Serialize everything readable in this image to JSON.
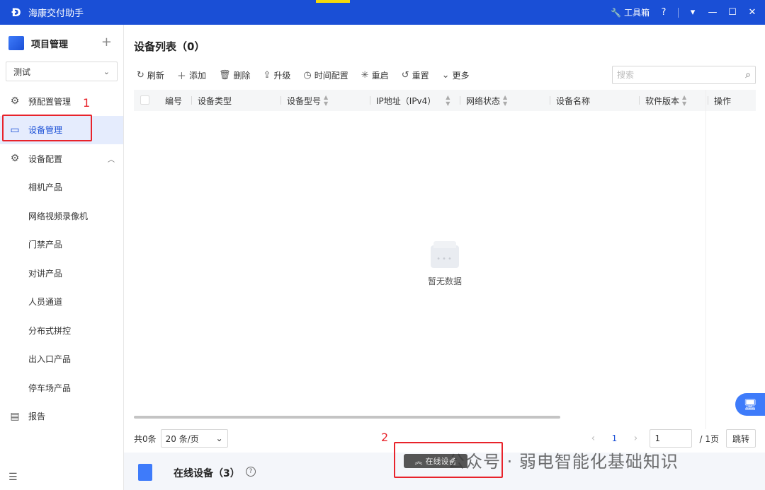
{
  "window": {
    "title": "海康交付助手",
    "toolbox_label": "工具箱",
    "help_icon": "question-circle-icon",
    "min_icon": "minimize-icon",
    "max_icon": "maximize-icon",
    "close_icon": "close-icon"
  },
  "sidebar": {
    "header_label": "项目管理",
    "project_selected": "测试",
    "items": [
      {
        "label": "预配置管理",
        "icon": "gear-cluster-icon"
      },
      {
        "label": "设备管理",
        "icon": "device-card-icon",
        "active": true
      },
      {
        "label": "设备配置",
        "icon": "device-config-icon",
        "expanded": true
      },
      {
        "label": "相机产品"
      },
      {
        "label": "网络视频录像机"
      },
      {
        "label": "门禁产品"
      },
      {
        "label": "对讲产品"
      },
      {
        "label": "人员通道"
      },
      {
        "label": "分布式拼控"
      },
      {
        "label": "出入口产品"
      },
      {
        "label": "停车场产品"
      },
      {
        "label": "报告",
        "icon": "report-icon"
      }
    ]
  },
  "main": {
    "title": "设备列表（0）",
    "toolbar": {
      "refresh": "刷新",
      "add": "添加",
      "delete": "删除",
      "upgrade": "升级",
      "time_config": "时间配置",
      "reboot": "重启",
      "reset": "重置",
      "more": "更多"
    },
    "search_placeholder": "搜索",
    "columns": [
      "编号",
      "设备类型",
      "设备型号",
      "IP地址（IPv4）",
      "网络状态",
      "设备名称",
      "软件版本",
      "操作"
    ],
    "empty_text": "暂无数据",
    "pager": {
      "total": "共0条",
      "page_size": "20 条/页",
      "current_page": "1",
      "page_input": "1",
      "total_pages": "/ 1页",
      "jump": "跳转"
    }
  },
  "online": {
    "label": "在线设备（3）",
    "collapse_label": "在线设备"
  },
  "annotations": {
    "one": "1",
    "two": "2",
    "color": "#e8232b"
  },
  "watermark": "公众号 · 弱电智能化基础知识",
  "colors": {
    "brand": "#1a4fd6",
    "active_bg": "#e5ecfd"
  }
}
